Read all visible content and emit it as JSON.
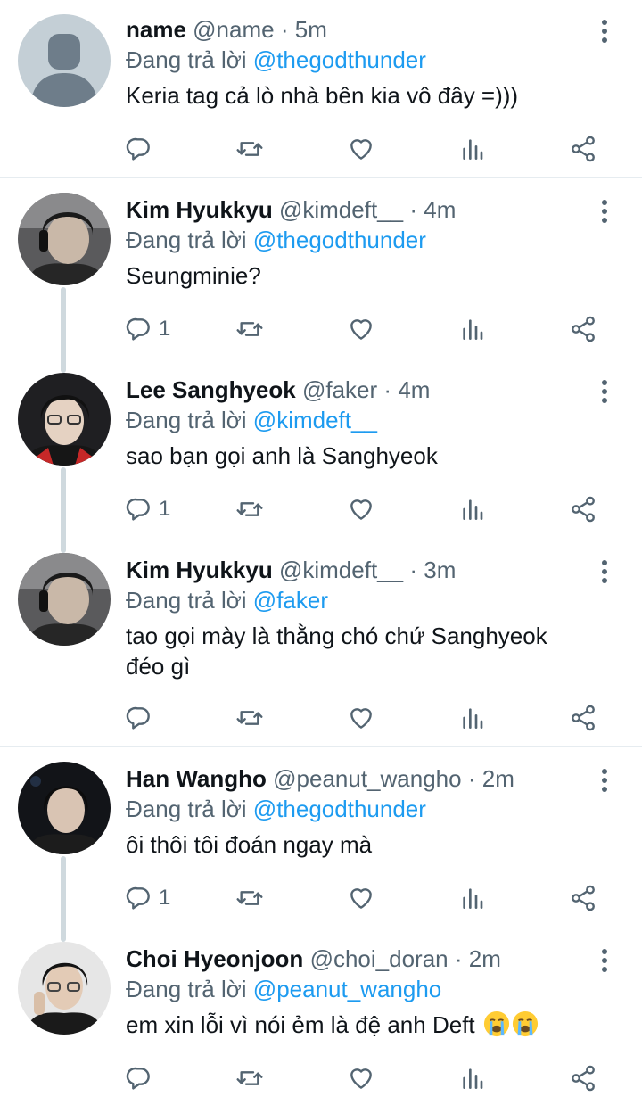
{
  "replying_prefix": "Đang trả lời",
  "tweets": [
    {
      "name": "name",
      "handle": "@name",
      "separator": "·",
      "time": "5m",
      "replying_to": "@thegodthunder",
      "text": "Keria tag cả lò nhà bên kia vô đây =)))",
      "reply_count": "",
      "avatar": "default-avatar"
    },
    {
      "name": "Kim Hyukkyu",
      "handle": "@kimdeft__",
      "separator": "·",
      "time": "4m",
      "replying_to": "@thegodthunder",
      "text": "Seungminie?",
      "reply_count": "1",
      "avatar": "photo-avatar"
    },
    {
      "name": "Lee Sanghyeok",
      "handle": "@faker",
      "separator": "·",
      "time": "4m",
      "replying_to": "@kimdeft__",
      "text": "sao bạn gọi anh là Sanghyeok",
      "reply_count": "1",
      "avatar": "photo-avatar"
    },
    {
      "name": "Kim Hyukkyu",
      "handle": "@kimdeft__",
      "separator": "·",
      "time": "3m",
      "replying_to": "@faker",
      "text": "tao gọi mày là thằng chó chứ Sanghyeok đéo gì",
      "reply_count": "",
      "avatar": "photo-avatar"
    },
    {
      "name": "Han Wangho",
      "handle": "@peanut_wangho",
      "separator": "·",
      "time": "2m",
      "replying_to": "@thegodthunder",
      "text": "ôi thôi tôi đoán ngay mà",
      "reply_count": "1",
      "avatar": "photo-avatar"
    },
    {
      "name": "Choi Hyeonjoon",
      "handle": "@choi_doran",
      "separator": "·",
      "time": "2m",
      "replying_to": "@peanut_wangho",
      "text": "em xin lỗi vì nói ẻm là đệ anh Deft",
      "reply_count": "",
      "avatar": "photo-avatar",
      "emoji": "loudly-crying-face-emoji"
    }
  ],
  "icons": {
    "reply": "reply-icon",
    "retweet": "retweet-icon",
    "like": "heart-icon",
    "stats": "stats-icon",
    "share": "share-icon",
    "more": "more-options-icon"
  },
  "colors": {
    "mention": "#1d9bf0",
    "secondary_text": "#536471",
    "thread_line": "#cfd9de",
    "divider": "#e6ecf0"
  }
}
